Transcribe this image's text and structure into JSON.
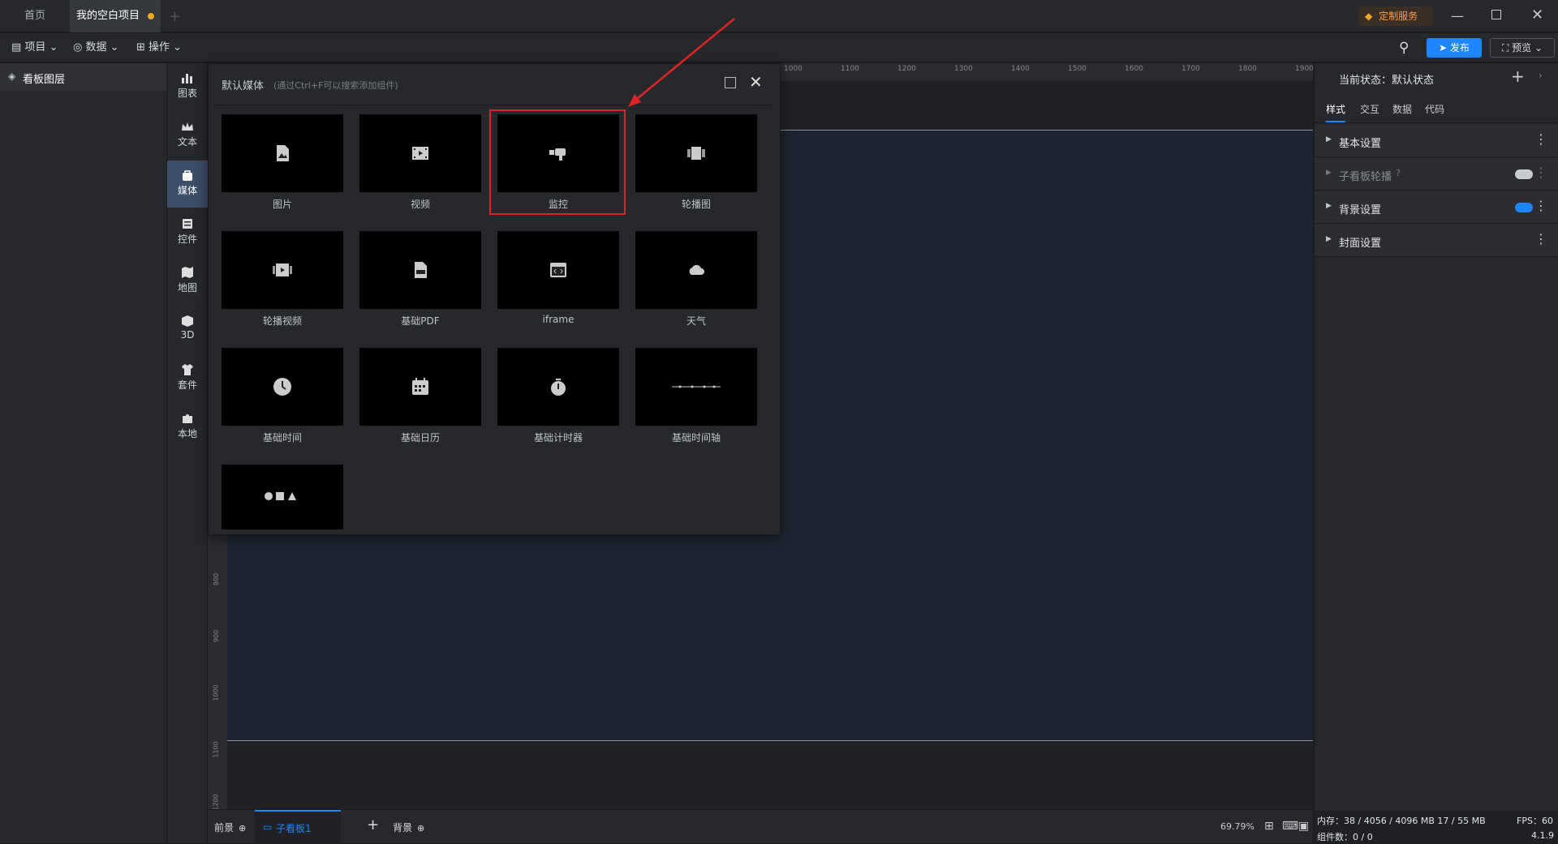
{
  "titlebar": {
    "home_tab": "首页",
    "project_tab": "我的空白项目",
    "custom_service": "定制服务"
  },
  "toolbar": {
    "project_menu": "项目",
    "data_menu": "数据",
    "operate_menu": "操作",
    "publish_label": "发布",
    "preview_label": "预览"
  },
  "left_panel": {
    "title": "看板图层"
  },
  "categories": [
    {
      "label": "图表"
    },
    {
      "label": "文本"
    },
    {
      "label": "媒体"
    },
    {
      "label": "控件"
    },
    {
      "label": "地图"
    },
    {
      "label": "3D"
    },
    {
      "label": "套件"
    },
    {
      "label": "本地"
    }
  ],
  "popup": {
    "title": "默认媒体",
    "hint": "(通过Ctrl+F可以搜索添加组件)",
    "items": [
      {
        "label": "图片",
        "icon": "image-icon"
      },
      {
        "label": "视频",
        "icon": "video-icon"
      },
      {
        "label": "监控",
        "icon": "camera-icon"
      },
      {
        "label": "轮播图",
        "icon": "carousel-icon"
      },
      {
        "label": "轮播视频",
        "icon": "video-carousel-icon"
      },
      {
        "label": "基础PDF",
        "icon": "pdf-icon"
      },
      {
        "label": "iframe",
        "icon": "iframe-icon"
      },
      {
        "label": "天气",
        "icon": "cloud-icon"
      },
      {
        "label": "基础时间",
        "icon": "clock-icon"
      },
      {
        "label": "基础日历",
        "icon": "calendar-icon"
      },
      {
        "label": "基础计时器",
        "icon": "timer-icon"
      },
      {
        "label": "基础时间轴",
        "icon": "timeline-icon"
      },
      {
        "label": "",
        "icon": "shapes-icon"
      }
    ]
  },
  "ruler_top": [
    "1000",
    "1100",
    "1200",
    "1300",
    "1400",
    "1500",
    "1600",
    "1700",
    "1800",
    "1900"
  ],
  "ruler_left": [
    "800",
    "900",
    "1000",
    "1100",
    "1200"
  ],
  "bottombar": {
    "foreground": "前景",
    "sub_board": "子看板1",
    "background": "背景",
    "zoom": "69.79%"
  },
  "right_panel": {
    "state_label": "当前状态：默认状态",
    "tabs": [
      "样式",
      "交互",
      "数据",
      "代码"
    ],
    "sections": [
      {
        "label": "基本设置"
      },
      {
        "label": "子看板轮播"
      },
      {
        "label": "背景设置"
      },
      {
        "label": "封面设置"
      }
    ]
  },
  "status": {
    "memory": "内存：38 / 4056 / 4096 MB  17 / 55 MB",
    "fps": "FPS：60",
    "components": "组件数：0 / 0",
    "version": "4.1.9"
  },
  "colors": {
    "accent": "#1e86ff",
    "highlight": "#e02424",
    "toggle_on": "#1e86ff"
  }
}
